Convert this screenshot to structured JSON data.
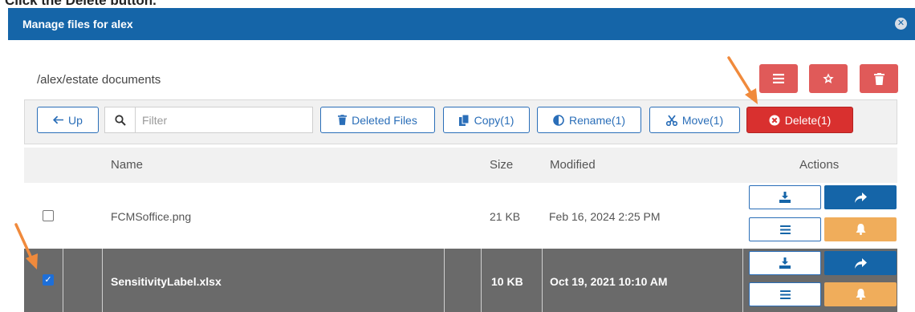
{
  "instruction": "Click the Delete button.",
  "dialog": {
    "title": "Manage files for alex",
    "close_icon": "close-icon"
  },
  "path": "/alex/estate documents",
  "top_actions": [
    {
      "name": "menu-button",
      "icon": "list-icon",
      "color": "#e05a59"
    },
    {
      "name": "favorite-button",
      "icon": "star-icon",
      "color": "#e05a59"
    },
    {
      "name": "trash-button",
      "icon": "trash-icon",
      "color": "#e05a59"
    }
  ],
  "toolbar": {
    "up_label": "Up",
    "filter_placeholder": "Filter",
    "deleted_files_label": "Deleted Files",
    "copy_label": "Copy(1)",
    "rename_label": "Rename(1)",
    "move_label": "Move(1)",
    "delete_label": "Delete(1)"
  },
  "table": {
    "columns": [
      "Name",
      "Size",
      "Modified",
      "Actions"
    ],
    "rows": [
      {
        "name": "FCMSoffice.png",
        "size": "21 KB",
        "modified": "Feb 16, 2024 2:25 PM",
        "checked": false
      },
      {
        "name": "SensitivityLabel.xlsx",
        "size": "10 KB",
        "modified": "Oct 19, 2021 10:10 AM",
        "checked": true
      }
    ]
  },
  "colors": {
    "title_bar": "#1565a8",
    "primary": "#2a6eb8",
    "danger": "#d9302f",
    "warning": "#f0ad5b",
    "selected_row": "#6a6a6a",
    "annotation_arrow": "#f08a3c"
  }
}
